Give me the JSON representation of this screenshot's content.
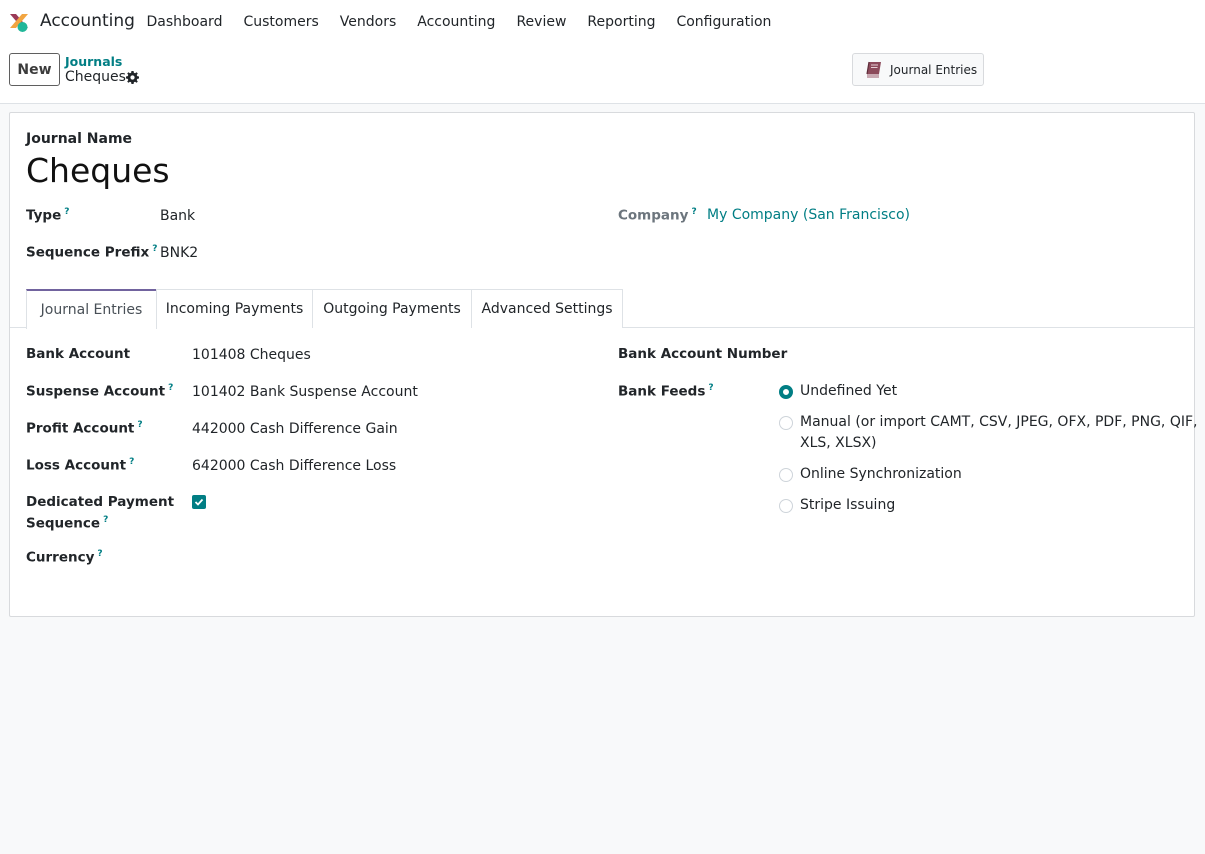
{
  "app": {
    "name": "Accounting",
    "menu": [
      "Dashboard",
      "Customers",
      "Vendors",
      "Accounting",
      "Review",
      "Reporting",
      "Configuration"
    ]
  },
  "control": {
    "new_label": "New",
    "breadcrumb_parent": "Journals",
    "breadcrumb_current": "Cheques",
    "smart_button_label": "Journal Entries"
  },
  "form": {
    "journal_name_label": "Journal Name",
    "journal_name": "Cheques",
    "type_label": "Type",
    "type_value": "Bank",
    "sequence_prefix_label": "Sequence Prefix",
    "sequence_prefix_value": "BNK2",
    "company_label": "Company",
    "company_value": "My Company (San Francisco)",
    "help_marker": "?"
  },
  "tabs": [
    "Journal Entries",
    "Incoming Payments",
    "Outgoing Payments",
    "Advanced Settings"
  ],
  "journal_entries_tab": {
    "bank_account_label": "Bank Account",
    "bank_account_value": "101408 Cheques",
    "suspense_account_label": "Suspense Account",
    "suspense_account_value": "101402 Bank Suspense Account",
    "profit_account_label": "Profit Account",
    "profit_account_value": "442000 Cash Difference Gain",
    "loss_account_label": "Loss Account",
    "loss_account_value": "642000 Cash Difference Loss",
    "dedicated_label_1": "Dedicated Payment",
    "dedicated_label_2": "Sequence",
    "dedicated_checked": true,
    "currency_label": "Currency",
    "bank_account_number_label": "Bank Account Number",
    "bank_feeds_label": "Bank Feeds",
    "bank_feeds_options": [
      {
        "label": "Undefined Yet",
        "checked": true
      },
      {
        "label_1": "Manual (or import CAMT, CSV, JPEG, OFX, PDF, PNG, QIF,",
        "label_2": "XLS, XLSX)",
        "checked": false
      },
      {
        "label": "Online Synchronization",
        "checked": false
      },
      {
        "label": "Stripe Issuing",
        "checked": false
      }
    ]
  },
  "colors": {
    "accent": "#017e84",
    "tab_active": "#71639e",
    "background": "#f8f9fa"
  }
}
